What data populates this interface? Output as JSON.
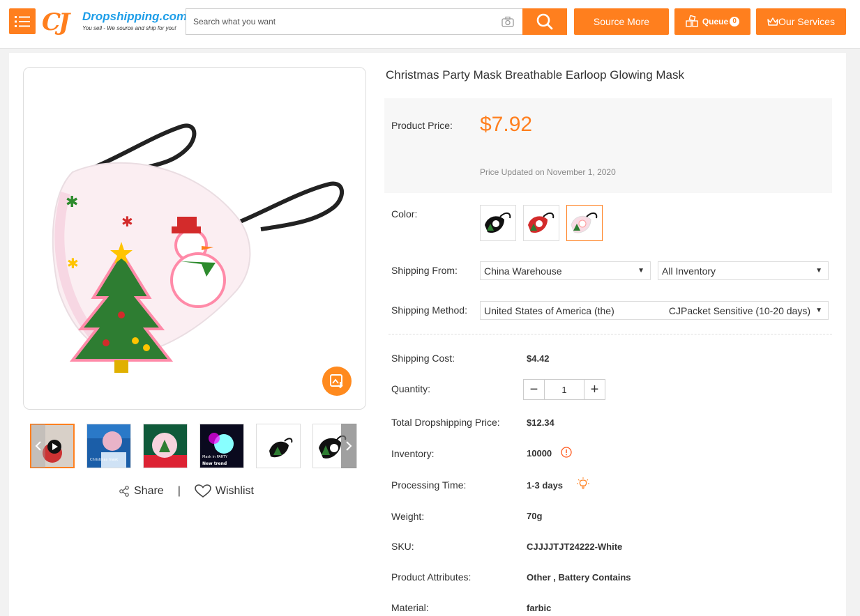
{
  "header": {
    "logo_cj": "CJ",
    "logo_name": "Dropshipping.com",
    "logo_tagline": "You sell - We source and ship for you!",
    "search_placeholder": "Search what you want",
    "source_more": "Source More",
    "queue_label": "Queue",
    "queue_count": "0",
    "our_services": "Our Services"
  },
  "gallery": {
    "share_label": "Share",
    "separator": "|",
    "wishlist_label": "Wishlist",
    "thumbnail_texts": [
      "Christmas mask",
      "Mask in PARTY",
      "New trend"
    ]
  },
  "product": {
    "title": "Christmas Party Mask Breathable Earloop Glowing Mask",
    "price_label": "Product Price:",
    "price": "$7.92",
    "price_updated": "Price Updated on November 1, 2020",
    "color_label": "Color:",
    "shipping_from_label": "Shipping From:",
    "shipping_from_value": "China Warehouse",
    "inventory_filter_value": "All Inventory",
    "shipping_method_label": "Shipping Method:",
    "shipping_country": "United States of America (the)",
    "shipping_carrier": "CJPacket Sensitive (10-20 days)",
    "shipping_cost_label": "Shipping Cost:",
    "shipping_cost": "$4.42",
    "quantity_label": "Quantity:",
    "quantity": "1",
    "total_label": "Total Dropshipping Price:",
    "total": "$12.34",
    "inventory_label": "Inventory:",
    "inventory": "10000",
    "processing_label": "Processing Time:",
    "processing": "1-3 days",
    "weight_label": "Weight:",
    "weight": "70g",
    "sku_label": "SKU:",
    "sku": "CJJJJTJT24222-White",
    "attributes_label": "Product Attributes:",
    "attributes": "Other , Battery Contains",
    "material_label": "Material:",
    "material": "farbic"
  },
  "colors": {
    "accent": "#ff7f1e",
    "logo_blue": "#1e9ee8"
  }
}
